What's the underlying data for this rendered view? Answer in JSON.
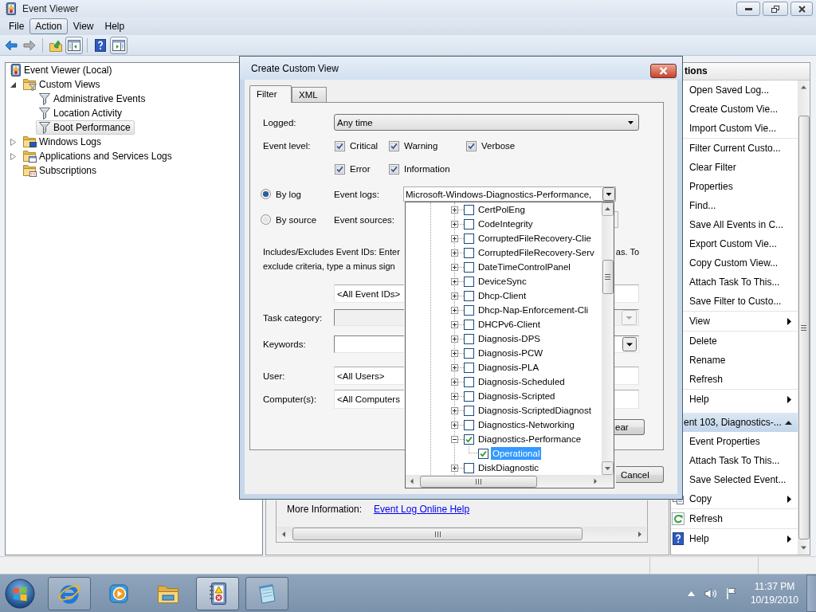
{
  "window": {
    "title": "Event Viewer"
  },
  "menu": [
    {
      "label": "File",
      "selected": false
    },
    {
      "label": "Action",
      "selected": true
    },
    {
      "label": "View",
      "selected": false
    },
    {
      "label": "Help",
      "selected": false
    }
  ],
  "toolbar": {
    "groups": [
      [
        {
          "disabled": false,
          "pressed": false
        },
        {
          "disabled": true,
          "pressed": false
        }
      ],
      [
        {
          "disabled": false,
          "pressed": false
        },
        {
          "disabled": false,
          "pressed": true
        }
      ],
      [
        {
          "disabled": false,
          "pressed": false
        },
        {
          "disabled": false,
          "pressed": true
        }
      ]
    ]
  },
  "tree": [
    {
      "label": "Event Viewer (Local)",
      "selected": false,
      "children": [
        {
          "label": "Custom Views",
          "selected": false,
          "expanded": true,
          "children": [
            {
              "label": "Administrative Events",
              "selected": false
            },
            {
              "label": "Location Activity",
              "selected": false
            },
            {
              "label": "Boot Performance",
              "selected": true
            }
          ]
        },
        {
          "label": "Windows Logs",
          "selected": false,
          "expanded": false
        },
        {
          "label": "Applications and Services Logs",
          "selected": false,
          "expanded": false
        },
        {
          "label": "Subscriptions",
          "selected": false
        }
      ]
    }
  ],
  "details_pane": {
    "more_info_label": "More Information:",
    "link": "Event Log Online Help"
  },
  "actions_pane": {
    "title": "tions",
    "sections": [
      {
        "groups": [
          [
            {
              "label": "Open Saved Log...",
              "submenu": false
            },
            {
              "label": "Create Custom Vie...",
              "submenu": false
            },
            {
              "label": "Import Custom Vie...",
              "submenu": false
            }
          ],
          [
            {
              "label": "Filter Current Custo...",
              "submenu": false
            },
            {
              "label": "Clear Filter",
              "submenu": false
            },
            {
              "label": "Properties",
              "submenu": false
            },
            {
              "label": "Find...",
              "submenu": false
            },
            {
              "label": "Save All Events in C...",
              "submenu": false
            },
            {
              "label": "Export Custom Vie...",
              "submenu": false
            },
            {
              "label": "Copy Custom View...",
              "submenu": false
            },
            {
              "label": "Attach Task To This...",
              "submenu": false
            },
            {
              "label": "Save Filter to Custo...",
              "submenu": false
            }
          ],
          [
            {
              "label": "View",
              "submenu": true
            }
          ],
          [
            {
              "label": "Delete",
              "submenu": false
            },
            {
              "label": "Rename",
              "submenu": false
            },
            {
              "label": "Refresh",
              "submenu": false
            }
          ],
          [
            {
              "label": "Help",
              "submenu": true
            }
          ]
        ]
      },
      {
        "title": "ent 103, Diagnostics-...",
        "expanded": true,
        "groups": [
          [
            {
              "label": "Event Properties",
              "submenu": false
            },
            {
              "label": "Attach Task To This...",
              "submenu": false
            },
            {
              "label": "Save Selected Event...",
              "submenu": false
            },
            {
              "label": "Copy",
              "submenu": true
            }
          ],
          [
            {
              "label": "Refresh",
              "submenu": false
            }
          ],
          [
            {
              "label": "Help",
              "submenu": true
            }
          ]
        ]
      }
    ]
  },
  "dialog": {
    "title": "Create Custom View",
    "tabs": [
      {
        "label": "Filter",
        "selected": true
      },
      {
        "label": "XML",
        "selected": false
      }
    ],
    "logged": {
      "label": "Logged:",
      "value": "Any time"
    },
    "event_level": {
      "label": "Event level:",
      "options": [
        {
          "label": "Critical",
          "checked": true
        },
        {
          "label": "Warning",
          "checked": true
        },
        {
          "label": "Verbose",
          "checked": true
        },
        {
          "label": "Error",
          "checked": true
        },
        {
          "label": "Information",
          "checked": true
        }
      ]
    },
    "sources": [
      {
        "label": "By log",
        "selected": true,
        "field_label": "Event logs:",
        "value": "Microsoft-Windows-Diagnostics-Performance,"
      },
      {
        "label": "By source",
        "selected": false,
        "field_label": "Event sources:"
      }
    ],
    "event_ids_note": {
      "line_1": "Includes/Excludes Event IDs: Enter",
      "line_1_end": "as. To",
      "line_2": "exclude criteria, type a minus sign"
    },
    "event_ids": {
      "value": "<All Event IDs>"
    },
    "task_category": {
      "label": "Task category:",
      "disabled": true
    },
    "keywords": {
      "label": "Keywords:",
      "disabled": false
    },
    "user": {
      "label": "User:",
      "value": "<All Users>"
    },
    "computers": {
      "label": "Computer(s):",
      "value": "<All Computers"
    },
    "clear_button": "ear",
    "cancel_button": "Cancel",
    "event_logs_list": {
      "items": [
        {
          "label": "CertPolEng",
          "checked": false,
          "expanded": false,
          "selected": false
        },
        {
          "label": "CodeIntegrity",
          "checked": false,
          "expanded": false,
          "selected": false
        },
        {
          "label": "CorruptedFileRecovery-Clie",
          "checked": false,
          "expanded": false,
          "selected": false
        },
        {
          "label": "CorruptedFileRecovery-Serv",
          "checked": false,
          "expanded": false,
          "selected": false
        },
        {
          "label": "DateTimeControlPanel",
          "checked": false,
          "expanded": false,
          "selected": false
        },
        {
          "label": "DeviceSync",
          "checked": false,
          "expanded": false,
          "selected": false
        },
        {
          "label": "Dhcp-Client",
          "checked": false,
          "expanded": false,
          "selected": false
        },
        {
          "label": "Dhcp-Nap-Enforcement-Cli",
          "checked": false,
          "expanded": false,
          "selected": false
        },
        {
          "label": "DHCPv6-Client",
          "checked": false,
          "expanded": false,
          "selected": false
        },
        {
          "label": "Diagnosis-DPS",
          "checked": false,
          "expanded": false,
          "selected": false
        },
        {
          "label": "Diagnosis-PCW",
          "checked": false,
          "expanded": false,
          "selected": false
        },
        {
          "label": "Diagnosis-PLA",
          "checked": false,
          "expanded": false,
          "selected": false
        },
        {
          "label": "Diagnosis-Scheduled",
          "checked": false,
          "expanded": false,
          "selected": false
        },
        {
          "label": "Diagnosis-Scripted",
          "checked": false,
          "expanded": false,
          "selected": false
        },
        {
          "label": "Diagnosis-ScriptedDiagnost",
          "checked": false,
          "expanded": false,
          "selected": false
        },
        {
          "label": "Diagnostics-Networking",
          "checked": false,
          "expanded": false,
          "selected": false
        },
        {
          "label": "Diagnostics-Performance",
          "checked": true,
          "expanded": true,
          "selected": false,
          "children": [
            {
              "label": "Operational",
              "checked": true,
              "selected": true
            }
          ]
        },
        {
          "label": "DiskDiagnostic",
          "checked": false,
          "expanded": false,
          "selected": false
        }
      ]
    }
  },
  "taskbar": {
    "buttons": [
      {
        "running": true,
        "active": false
      },
      {
        "running": false,
        "active": false
      },
      {
        "running": false,
        "active": false
      },
      {
        "running": true,
        "active": true
      },
      {
        "running": true,
        "active": false
      }
    ],
    "clock": {
      "time": "11:37 PM",
      "date": "10/19/2010"
    }
  }
}
